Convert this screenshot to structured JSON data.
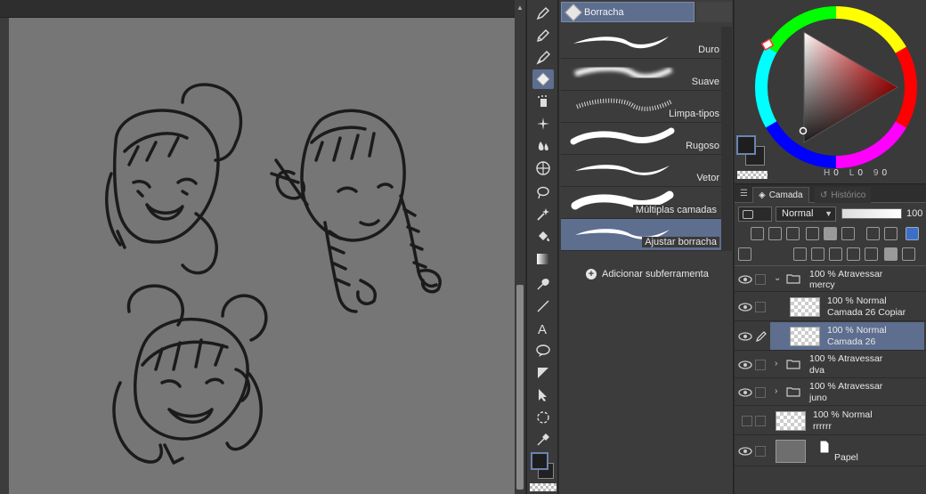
{
  "subtool": {
    "title": "Borracha",
    "brushes": [
      {
        "name": "Duro"
      },
      {
        "name": "Suave"
      },
      {
        "name": "Limpa-tipos"
      },
      {
        "name": "Rugoso"
      },
      {
        "name": "Vetor"
      },
      {
        "name": "Múltiplas camadas"
      },
      {
        "name": "Ajustar borracha"
      }
    ],
    "add_label": "Adicionar subferramenta"
  },
  "color": {
    "main": "#1e1e1e",
    "sub": "#222222",
    "h_label": "H",
    "h": "0",
    "s_label": "L",
    "s": "0",
    "v_label": "9",
    "v": "0"
  },
  "layers_panel": {
    "tab_layer": "Camada",
    "tab_history": "Histórico",
    "blend_mode": "Normal",
    "opacity": "100",
    "layers": [
      {
        "line1": "100 % Atravessar",
        "line2": "mercy",
        "type": "folder",
        "expanded": true
      },
      {
        "line1": "100 % Normal",
        "line2": "Camada 26 Copiar",
        "type": "raster"
      },
      {
        "line1": "100 % Normal",
        "line2": "Camada 26",
        "type": "raster",
        "selected": true
      },
      {
        "line1": "100 % Atravessar",
        "line2": "dva",
        "type": "folder"
      },
      {
        "line1": "100 % Atravessar",
        "line2": "juno",
        "type": "folder"
      },
      {
        "line1": "100 % Normal",
        "line2": "rrrrrr",
        "type": "raster"
      },
      {
        "line1": "",
        "line2": "Papel",
        "type": "paper"
      }
    ]
  },
  "tools": [
    "pen-icon",
    "pencil-icon",
    "brush-icon",
    "eraser-icon",
    "airbrush-icon",
    "decoration-icon",
    "blend-icon",
    "grid-icon",
    "lasso-icon",
    "magic-wand-icon",
    "fill-icon",
    "gradient-icon",
    "eyedropper-icon",
    "line-icon",
    "text-icon",
    "balloon-icon",
    "ruler-icon",
    "object-icon",
    "rotate-icon",
    "dropper-icon"
  ]
}
